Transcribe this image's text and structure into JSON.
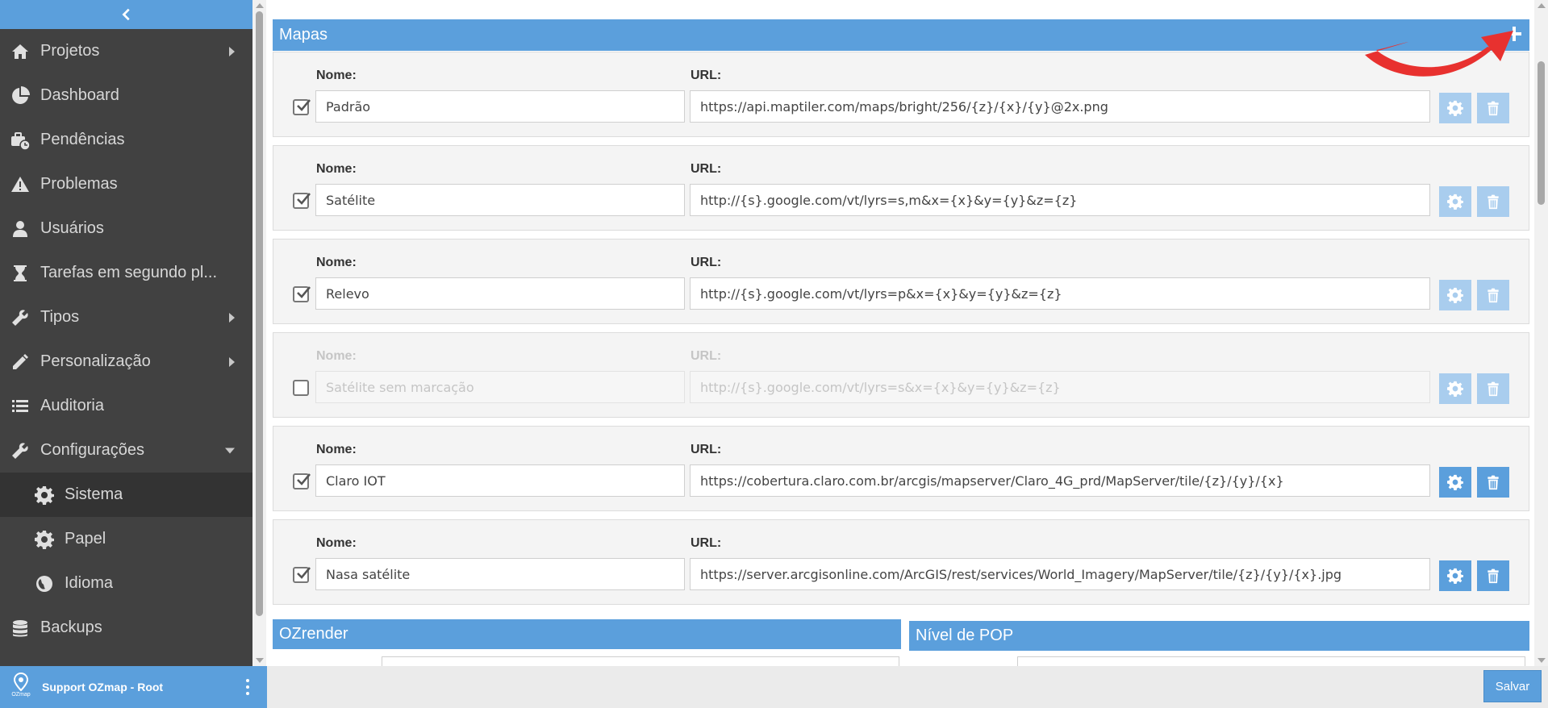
{
  "sidebar": {
    "collapse_icon": "chevron-left-icon",
    "items": [
      {
        "label": "Projetos",
        "icon": "home-icon",
        "caret": "right"
      },
      {
        "label": "Dashboard",
        "icon": "pie-chart-icon",
        "caret": ""
      },
      {
        "label": "Pendências",
        "icon": "briefcase-clock-icon",
        "caret": ""
      },
      {
        "label": "Problemas",
        "icon": "warning-icon",
        "caret": ""
      },
      {
        "label": "Usuários",
        "icon": "user-icon",
        "caret": ""
      },
      {
        "label": "Tarefas em segundo pl...",
        "icon": "hourglass-icon",
        "caret": ""
      },
      {
        "label": "Tipos",
        "icon": "wrench-icon",
        "caret": "right"
      },
      {
        "label": "Personalização",
        "icon": "pencil-icon",
        "caret": "right"
      },
      {
        "label": "Auditoria",
        "icon": "list-icon",
        "caret": ""
      },
      {
        "label": "Configurações",
        "icon": "wrench-icon",
        "caret": "down"
      },
      {
        "label": "Sistema",
        "icon": "gear-icon",
        "sub": true,
        "active": true
      },
      {
        "label": "Papel",
        "icon": "gear-icon",
        "sub": true
      },
      {
        "label": "Idioma",
        "icon": "globe-icon",
        "sub": true
      },
      {
        "label": "Backups",
        "icon": "database-icon",
        "caret": ""
      }
    ]
  },
  "user_bar": {
    "logo_text": "OZmap",
    "name": "Support OZmap - Root"
  },
  "footer": {
    "save_label": "Salvar"
  },
  "maps": {
    "title": "Mapas",
    "name_label": "Nome:",
    "url_label": "URL:",
    "rows": [
      {
        "name": "Padrão",
        "url": "https://api.maptiler.com/maps/bright/256/{z}/{x}/{y}@2x.png",
        "checked": true,
        "enabled": true,
        "actions_dim": true
      },
      {
        "name": "Satélite",
        "url": "http://{s}.google.com/vt/lyrs=s,m&x={x}&y={y}&z={z}",
        "checked": true,
        "enabled": true,
        "actions_dim": true
      },
      {
        "name": "Relevo",
        "url": "http://{s}.google.com/vt/lyrs=p&x={x}&y={y}&z={z}",
        "checked": true,
        "enabled": true,
        "actions_dim": true
      },
      {
        "name": "Satélite sem marcação",
        "url": "http://{s}.google.com/vt/lyrs=s&x={x}&y={y}&z={z}",
        "checked": false,
        "enabled": false,
        "actions_dim": true
      },
      {
        "name": "Claro IOT",
        "url": "https://cobertura.claro.com.br/arcgis/mapserver/Claro_4G_prd/MapServer/tile/{z}/{y}/{x}",
        "checked": true,
        "enabled": true,
        "actions_dim": false
      },
      {
        "name": "Nasa satélite",
        "url": "https://server.arcgisonline.com/ArcGIS/rest/services/World_Imagery/MapServer/tile/{z}/{y}/{x}.jpg",
        "checked": true,
        "enabled": true,
        "actions_dim": false
      }
    ]
  },
  "sections": {
    "ozrender_title": "OZrender",
    "pop_title": "Nível de POP"
  },
  "colors": {
    "accent": "#5b9fdc",
    "sidebar_bg": "#414141",
    "annotation_arrow": "#e8312f"
  }
}
